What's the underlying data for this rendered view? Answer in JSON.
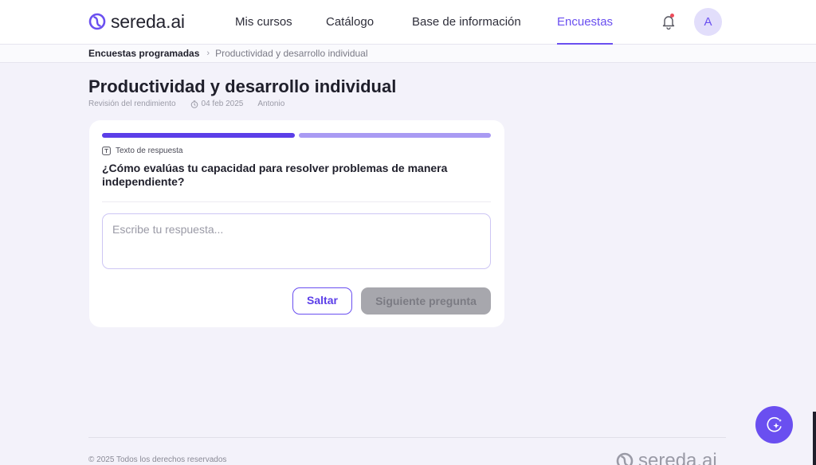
{
  "brand": {
    "name": "sereda.ai",
    "accent": "#6a4ff0"
  },
  "nav": {
    "items": [
      {
        "label": "Mis cursos"
      },
      {
        "label": "Catálogo"
      },
      {
        "label": "Base de información"
      },
      {
        "label": "Encuestas",
        "active": true
      }
    ],
    "notification_icon": "bell-icon",
    "avatar_initial": "A"
  },
  "breadcrumb": {
    "root": "Encuestas programadas",
    "separator_icon": "chevron-right-icon",
    "current": "Productividad y desarrollo individual"
  },
  "page": {
    "title": "Productividad y desarrollo individual",
    "meta": {
      "category": "Revisión del rendimiento",
      "date": "04 feb 2025",
      "author": "Antonio"
    }
  },
  "survey": {
    "progress": {
      "current": 1,
      "total": 2
    },
    "question_type": "Texto de respuesta",
    "question": "¿Cómo evalúas tu capacidad para resolver problemas de manera independiente?",
    "answer": {
      "value": "",
      "placeholder": "Escribe tu respuesta..."
    },
    "skip_label": "Saltar",
    "next_label": "Siguiente pregunta"
  },
  "assistant_button_icon": "ai-sparkle-icon",
  "footer": {
    "copyright": "© 2025 Todos los derechos reservados",
    "logo_text": "sereda.ai"
  }
}
